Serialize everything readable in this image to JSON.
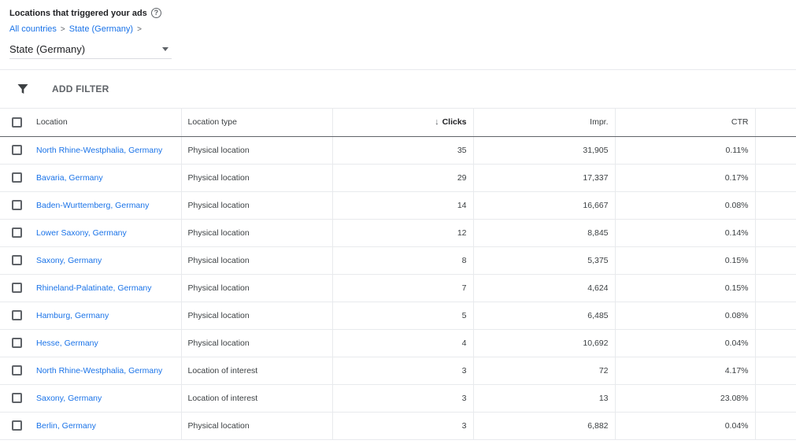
{
  "header": {
    "title": "Locations that triggered your ads",
    "help_glyph": "?"
  },
  "breadcrumb": {
    "items": [
      "All countries",
      "State (Germany)"
    ],
    "separator": ">"
  },
  "level_select": {
    "value": "State (Germany)"
  },
  "filter_bar": {
    "add_filter_label": "ADD FILTER"
  },
  "table": {
    "columns": {
      "location": "Location",
      "location_type": "Location type",
      "clicks": "Clicks",
      "clicks_sort_glyph": "↓",
      "impr": "Impr.",
      "ctr": "CTR"
    },
    "rows": [
      {
        "location": "North Rhine-Westphalia, Germany",
        "type": "Physical location",
        "clicks": "35",
        "impr": "31,905",
        "ctr": "0.11%"
      },
      {
        "location": "Bavaria, Germany",
        "type": "Physical location",
        "clicks": "29",
        "impr": "17,337",
        "ctr": "0.17%"
      },
      {
        "location": "Baden-Wurttemberg, Germany",
        "type": "Physical location",
        "clicks": "14",
        "impr": "16,667",
        "ctr": "0.08%"
      },
      {
        "location": "Lower Saxony, Germany",
        "type": "Physical location",
        "clicks": "12",
        "impr": "8,845",
        "ctr": "0.14%"
      },
      {
        "location": "Saxony, Germany",
        "type": "Physical location",
        "clicks": "8",
        "impr": "5,375",
        "ctr": "0.15%"
      },
      {
        "location": "Rhineland-Palatinate, Germany",
        "type": "Physical location",
        "clicks": "7",
        "impr": "4,624",
        "ctr": "0.15%"
      },
      {
        "location": "Hamburg, Germany",
        "type": "Physical location",
        "clicks": "5",
        "impr": "6,485",
        "ctr": "0.08%"
      },
      {
        "location": "Hesse, Germany",
        "type": "Physical location",
        "clicks": "4",
        "impr": "10,692",
        "ctr": "0.04%"
      },
      {
        "location": "North Rhine-Westphalia, Germany",
        "type": "Location of interest",
        "clicks": "3",
        "impr": "72",
        "ctr": "4.17%"
      },
      {
        "location": "Saxony, Germany",
        "type": "Location of interest",
        "clicks": "3",
        "impr": "13",
        "ctr": "23.08%"
      },
      {
        "location": "Berlin, Germany",
        "type": "Physical location",
        "clicks": "3",
        "impr": "6,882",
        "ctr": "0.04%"
      }
    ]
  },
  "colors": {
    "link": "#1a73e8",
    "text": "#202124",
    "muted": "#5f6368",
    "divider": "#e8eaed"
  }
}
